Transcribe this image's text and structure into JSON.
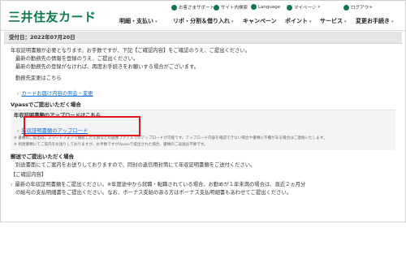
{
  "header": {
    "logo": "三井住友カード",
    "utility": [
      {
        "icon": "question-circle-icon",
        "label": "お客さまサポート"
      },
      {
        "icon": "sitemap-icon",
        "label": "サイト内検索"
      },
      {
        "icon": "globe-icon",
        "label": "Language"
      },
      {
        "icon": "person-icon",
        "label": "マイページ"
      },
      {
        "icon": "door-icon",
        "label": "ログアウト"
      }
    ],
    "nav": [
      {
        "label": "明細・支払い"
      },
      {
        "label": "リボ・分割＆借り入れ"
      },
      {
        "label": "キャンペーン"
      },
      {
        "label": "ポイント"
      },
      {
        "label": "サービス"
      },
      {
        "label": "変更お手続き"
      }
    ]
  },
  "content": {
    "date_bar": "受付日：2022年07月20日",
    "intro": "年収証明書類が必要となります。お手数ですが、下記【ご確認内容】をご確認のうえ、ご提出ください。",
    "employ1": "最新の勤務先の情報を登録のうえ、ご提出ください。",
    "employ2": "最新の勤務先の登録がなければ、再度お手続きをお願いする場合がございます。",
    "change_label": "勤務先変更はこちら",
    "change_link": "カードお届け内容の照会・変更",
    "vpass_heading": "Vpassでご提出いただく場合",
    "upload_label": "年収証明書類のアップロードはこちら",
    "upload_link": "年収証明書類のアップロード",
    "note1": "※ 書類のご提出は、スマートフォンで撮影した写真などの画像ファイルでのアップロードが可能です。アップロード内容を確認できない場合や書類に不備がある場合はご連絡いたします。",
    "note2": "※ 到達書類にてご案内をお送りしておりますが、お手数ですがVpassで提出された場合、書類のご返送は不要です。",
    "mail_heading": "郵送でご提出いただく場合",
    "mail_text": "別途書面にてご案内をお送りしておりますので、同封の返信用封筒にて年収証明書類をご送付ください。",
    "confirm_heading": "【ご確認内容】",
    "confirm1": "最新の年収証明書類をご提出ください。※年度途中から就職・転職されている場合、お勤めが１年未満の場合は、直近２ヵ月分",
    "confirm2": "の給与の支払明細書をご提出ください。なお、ボーナス支給のある方はボーナス支払明細書もあわせてご提出ください。"
  },
  "colors": {
    "brand_green": "#0a7a4a",
    "link_blue": "#0a6bd6",
    "highlight_red": "#e01818",
    "date_bar_bg": "#e6e6e6"
  }
}
